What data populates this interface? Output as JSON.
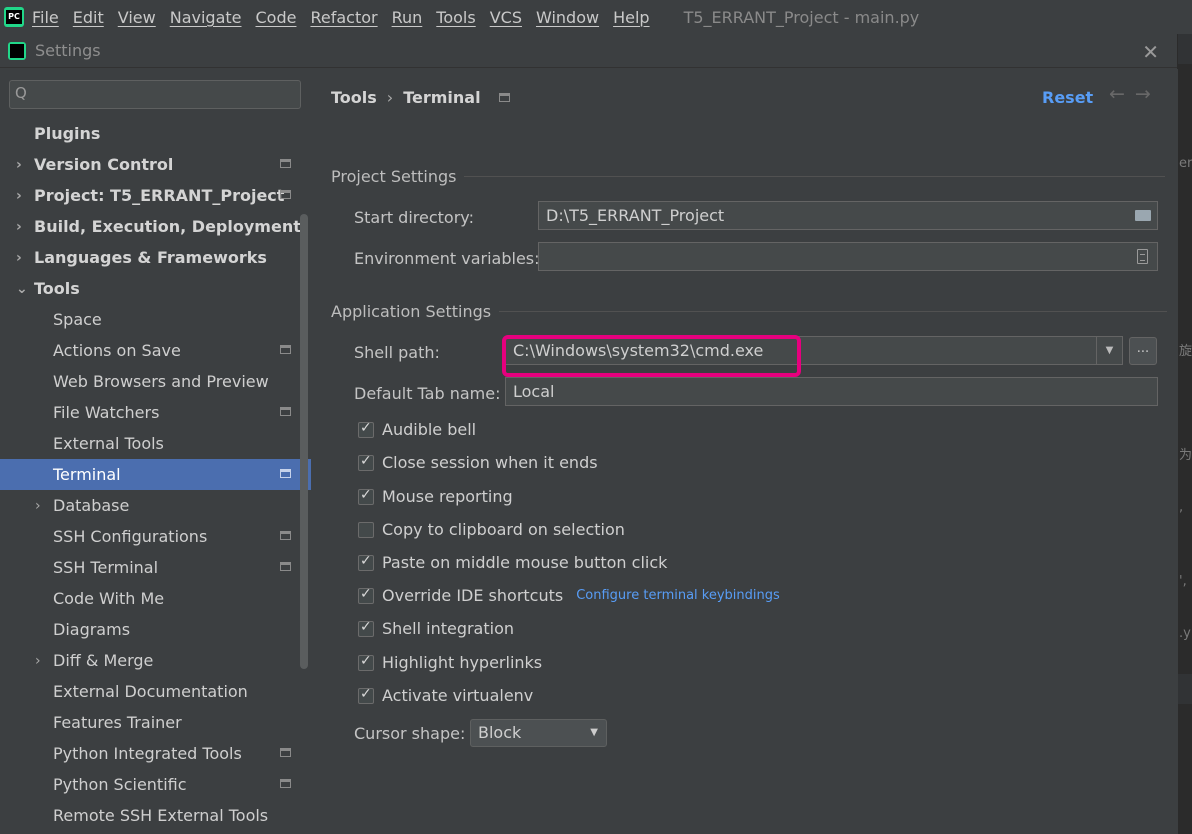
{
  "menubar": {
    "items": [
      "File",
      "Edit",
      "View",
      "Navigate",
      "Code",
      "Refactor",
      "Run",
      "Tools",
      "VCS",
      "Window",
      "Help"
    ],
    "window_title": "T5_ERRANT_Project - main.py"
  },
  "dialog": {
    "title": "Settings",
    "close_glyph": "✕"
  },
  "sidebar": {
    "search_glyph": "Q",
    "items": [
      {
        "label": "Plugins",
        "arrow": ""
      },
      {
        "label": "Version Control",
        "arrow": "›"
      },
      {
        "label": "Project: T5_ERRANT_Project",
        "arrow": "›"
      },
      {
        "label": "Build, Execution, Deployment",
        "arrow": "›"
      },
      {
        "label": "Languages & Frameworks",
        "arrow": "›"
      },
      {
        "label": "Tools",
        "arrow": "⌄"
      },
      {
        "label": "Space",
        "arrow": ""
      },
      {
        "label": "Actions on Save",
        "arrow": ""
      },
      {
        "label": "Web Browsers and Preview",
        "arrow": ""
      },
      {
        "label": "File Watchers",
        "arrow": ""
      },
      {
        "label": "External Tools",
        "arrow": ""
      },
      {
        "label": "Terminal",
        "arrow": ""
      },
      {
        "label": "Database",
        "arrow": "›"
      },
      {
        "label": "SSH Configurations",
        "arrow": ""
      },
      {
        "label": "SSH Terminal",
        "arrow": ""
      },
      {
        "label": "Code With Me",
        "arrow": ""
      },
      {
        "label": "Diagrams",
        "arrow": ""
      },
      {
        "label": "Diff & Merge",
        "arrow": "›"
      },
      {
        "label": "External Documentation",
        "arrow": ""
      },
      {
        "label": "Features Trainer",
        "arrow": ""
      },
      {
        "label": "Python Integrated Tools",
        "arrow": ""
      },
      {
        "label": "Python Scientific",
        "arrow": ""
      },
      {
        "label": "Remote SSH External Tools",
        "arrow": ""
      }
    ]
  },
  "content": {
    "breadcrumb": {
      "parent": "Tools",
      "sep": "›",
      "current": "Terminal"
    },
    "reset_label": "Reset",
    "nav_arrows": "←→",
    "project_settings": {
      "title": "Project Settings",
      "start_directory_label": "Start directory:",
      "start_directory_value": "D:\\T5_ERRANT_Project",
      "env_vars_label": "Environment variables:",
      "env_vars_value": ""
    },
    "application_settings": {
      "title": "Application Settings",
      "shell_path_label": "Shell path:",
      "shell_path_value": "C:\\Windows\\system32\\cmd.exe",
      "shell_path_combo_arrow": "▼",
      "browse_button_label": "...",
      "default_tab_label": "Default Tab name:",
      "default_tab_value": "Local",
      "checkboxes": [
        {
          "label": "Audible bell",
          "checked": true
        },
        {
          "label": "Close session when it ends",
          "checked": true
        },
        {
          "label": "Mouse reporting",
          "checked": true
        },
        {
          "label": "Copy to clipboard on selection",
          "checked": false
        },
        {
          "label": "Paste on middle mouse button click",
          "checked": true
        },
        {
          "label": "Override IDE shortcuts",
          "checked": true
        },
        {
          "label": "Shell integration",
          "checked": true
        },
        {
          "label": "Highlight hyperlinks",
          "checked": true
        },
        {
          "label": "Activate virtualenv",
          "checked": true
        }
      ],
      "keybindings_link": "Configure terminal keybindings",
      "cursor_shape_label": "Cursor shape:",
      "cursor_shape_value": "Block",
      "cursor_shape_caret": "▼"
    }
  },
  "background_fragments": [
    "er",
    "旋",
    "为",
    ",",
    "',",
    ".y"
  ],
  "colors": {
    "selection": "#4b6eaf",
    "link": "#589df6",
    "highlight_box": "#e6007e"
  }
}
